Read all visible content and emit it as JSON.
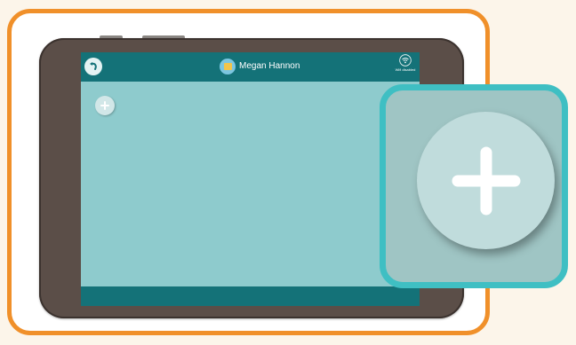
{
  "header": {
    "user_name": "Megan Hannon",
    "wifi_status": "Wifi disabled"
  },
  "icons": {
    "back": "back-arrow-icon",
    "avatar": "user-avatar-icon",
    "wifi": "wifi-icon",
    "add": "plus-icon"
  },
  "colors": {
    "outer_frame": "#f0902a",
    "app_bar": "#147278",
    "screen_background": "#8ecbcd",
    "zoom_border": "#3fbfc3",
    "add_button": "#d2e7e8"
  }
}
